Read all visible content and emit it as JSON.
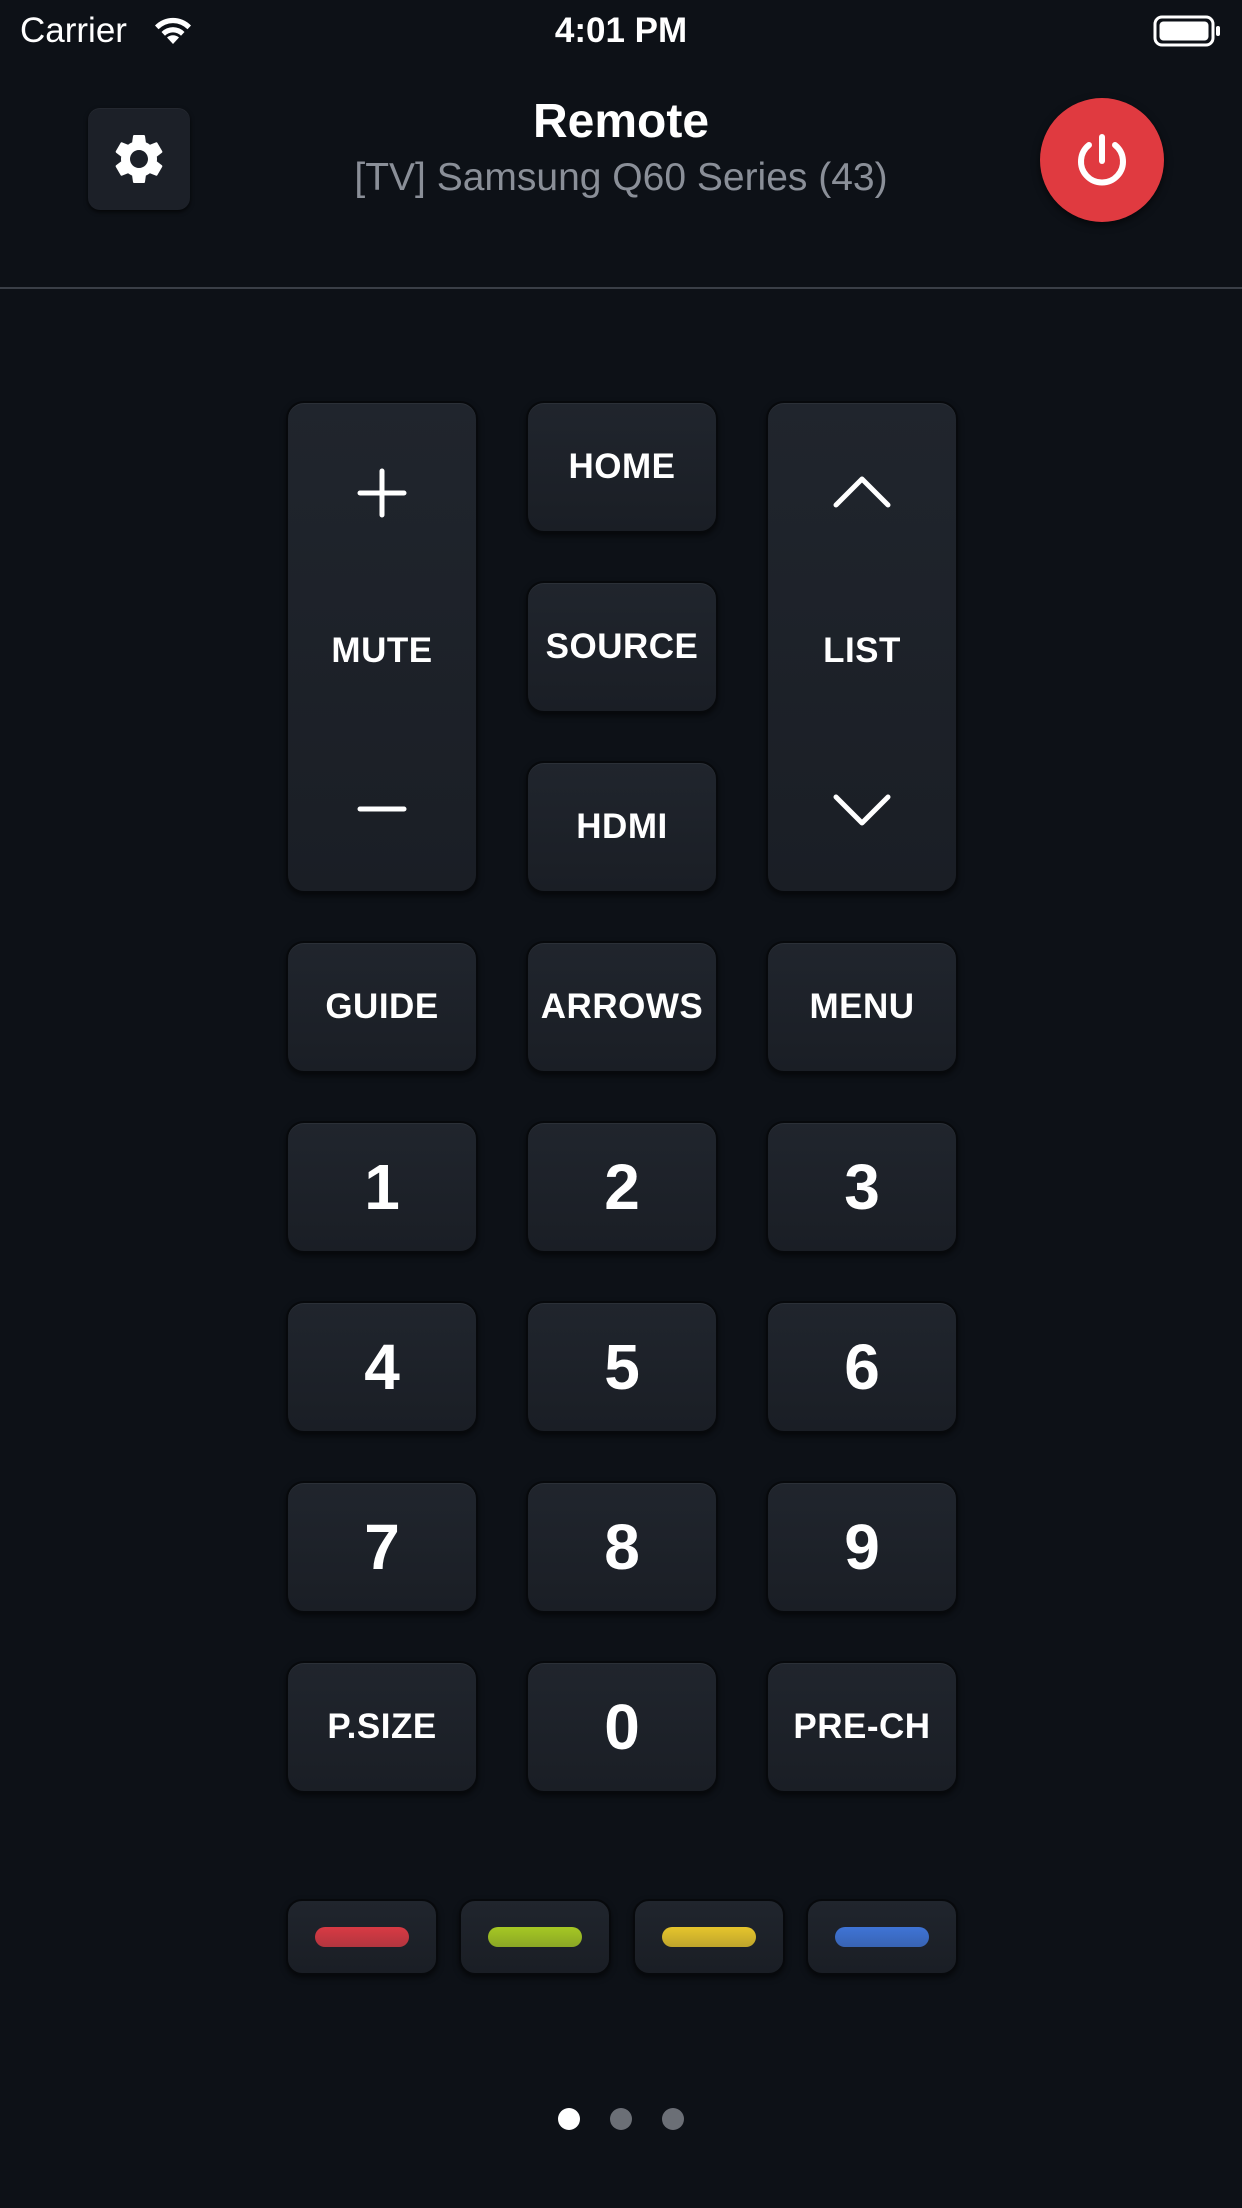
{
  "status_bar": {
    "carrier": "Carrier",
    "time": "4:01 PM",
    "wifi_icon": "wifi-icon",
    "battery_icon": "battery-full-icon"
  },
  "header": {
    "title": "Remote",
    "device_name": "[TV] Samsung Q60 Series (43)",
    "settings_icon": "gear-icon",
    "power_icon": "power-icon",
    "power_color": "#e03a40"
  },
  "remote": {
    "volume": {
      "label": "MUTE",
      "up_icon": "plus-icon",
      "down_icon": "minus-icon"
    },
    "channel": {
      "label": "LIST",
      "up_icon": "chevron-up-icon",
      "down_icon": "chevron-down-icon"
    },
    "home": "HOME",
    "source": "SOURCE",
    "hdmi": "HDMI",
    "guide": "GUIDE",
    "arrows": "ARROWS",
    "menu": "MENU",
    "digits": [
      "1",
      "2",
      "3",
      "4",
      "5",
      "6",
      "7",
      "8",
      "9",
      "0"
    ],
    "psize": "P.SIZE",
    "prech": "PRE-CH"
  },
  "color_keys": [
    {
      "name": "red",
      "color": "#d83a44"
    },
    {
      "name": "green",
      "color": "#a6c824"
    },
    {
      "name": "yellow",
      "color": "#e6c52c"
    },
    {
      "name": "blue",
      "color": "#3f74d6"
    }
  ],
  "pager": {
    "pages": 3,
    "active": 1
  }
}
